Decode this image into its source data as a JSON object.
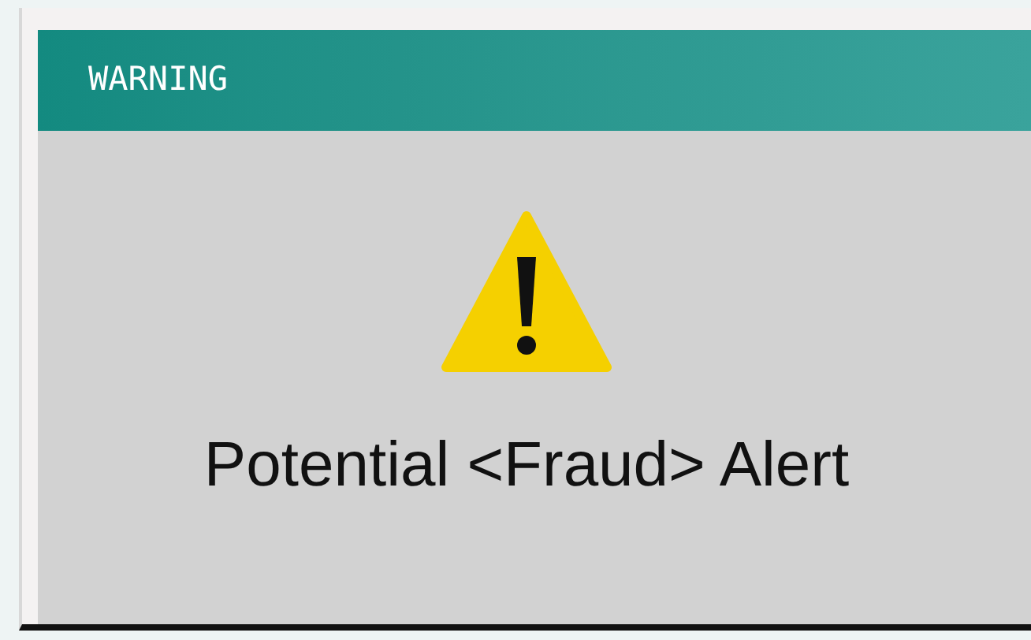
{
  "dialog": {
    "title": "WARNING",
    "message": "Potential <Fraud> Alert"
  }
}
